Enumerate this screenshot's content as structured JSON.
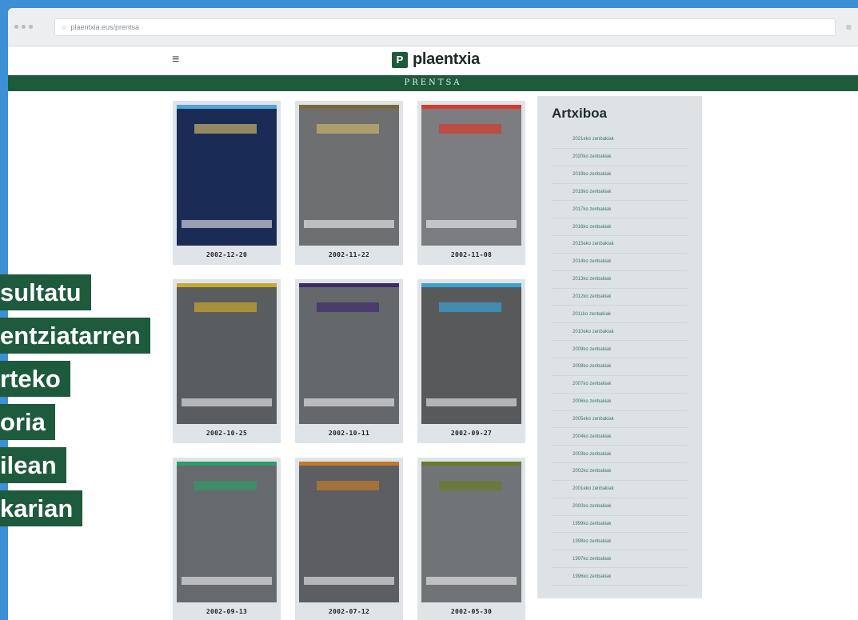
{
  "browser": {
    "url": "plaentxia.eus/prentsa",
    "menu_icon": "menu-icon"
  },
  "header": {
    "logo_mark": "P",
    "logo_text": "plaentxia",
    "menu_icon": "hamburger-icon"
  },
  "section_title": "PRENTSA",
  "issues": [
    {
      "date": "2002-12-20",
      "top": "#4fa6d8",
      "bg": "#1a2b55",
      "masthead": "#c8b36a"
    },
    {
      "date": "2002-11-22",
      "top": "#7a6a3a",
      "bg": "#6d6f71",
      "masthead": "#c8b36a"
    },
    {
      "date": "2002-11-08",
      "top": "#d8382e",
      "bg": "#7b7d80",
      "masthead": "#d8382e"
    },
    {
      "date": "2002-10-25",
      "top": "#c9a92a",
      "bg": "#5a5d60",
      "masthead": "#c9a92a"
    },
    {
      "date": "2002-10-11",
      "top": "#3d2a6a",
      "bg": "#65686b",
      "masthead": "#3d2a6a"
    },
    {
      "date": "2002-09-27",
      "top": "#3aa3d4",
      "bg": "#58595b",
      "masthead": "#3aa3d4"
    },
    {
      "date": "2002-09-13",
      "top": "#2f9a6a",
      "bg": "#666a6d",
      "masthead": "#2f9a6a"
    },
    {
      "date": "2002-07-12",
      "top": "#c07a2a",
      "bg": "#5c5e61",
      "masthead": "#c07a2a"
    },
    {
      "date": "2002-05-30",
      "top": "#6a7a2a",
      "bg": "#717476",
      "masthead": "#6a7a2a"
    }
  ],
  "archive": {
    "title": "Artxiboa",
    "items": [
      "2021eko zenbakiak",
      "2020ko zenbakiak",
      "2019ko zenbakiak",
      "2018ko zenbakiak",
      "2017ko zenbakiak",
      "2016ko zenbakiak",
      "2015eko zenbakiak",
      "2014ko zenbakiak",
      "2013ko zenbakiak",
      "2012ko zenbakiak",
      "2011ko zenbakiak",
      "2010eko zenbakiak",
      "2009ko zenbakiak",
      "2008ko zenbakiak",
      "2007ko zenbakiak",
      "2006ko zenbakiak",
      "2005eko zenbakiak",
      "2004ko zenbakiak",
      "2003ko zenbakiak",
      "2002ko zenbakiak",
      "2001eko zenbakiak",
      "2000ko zenbakiak",
      "1999ko zenbakiak",
      "1998ko zenbakiak",
      "1997ko zenbakiak",
      "1996ko zenbakiak"
    ]
  },
  "overlay": {
    "lines": [
      "sultatu",
      "entziatarren",
      "rteko",
      "oria",
      "ilean",
      "karian"
    ]
  }
}
